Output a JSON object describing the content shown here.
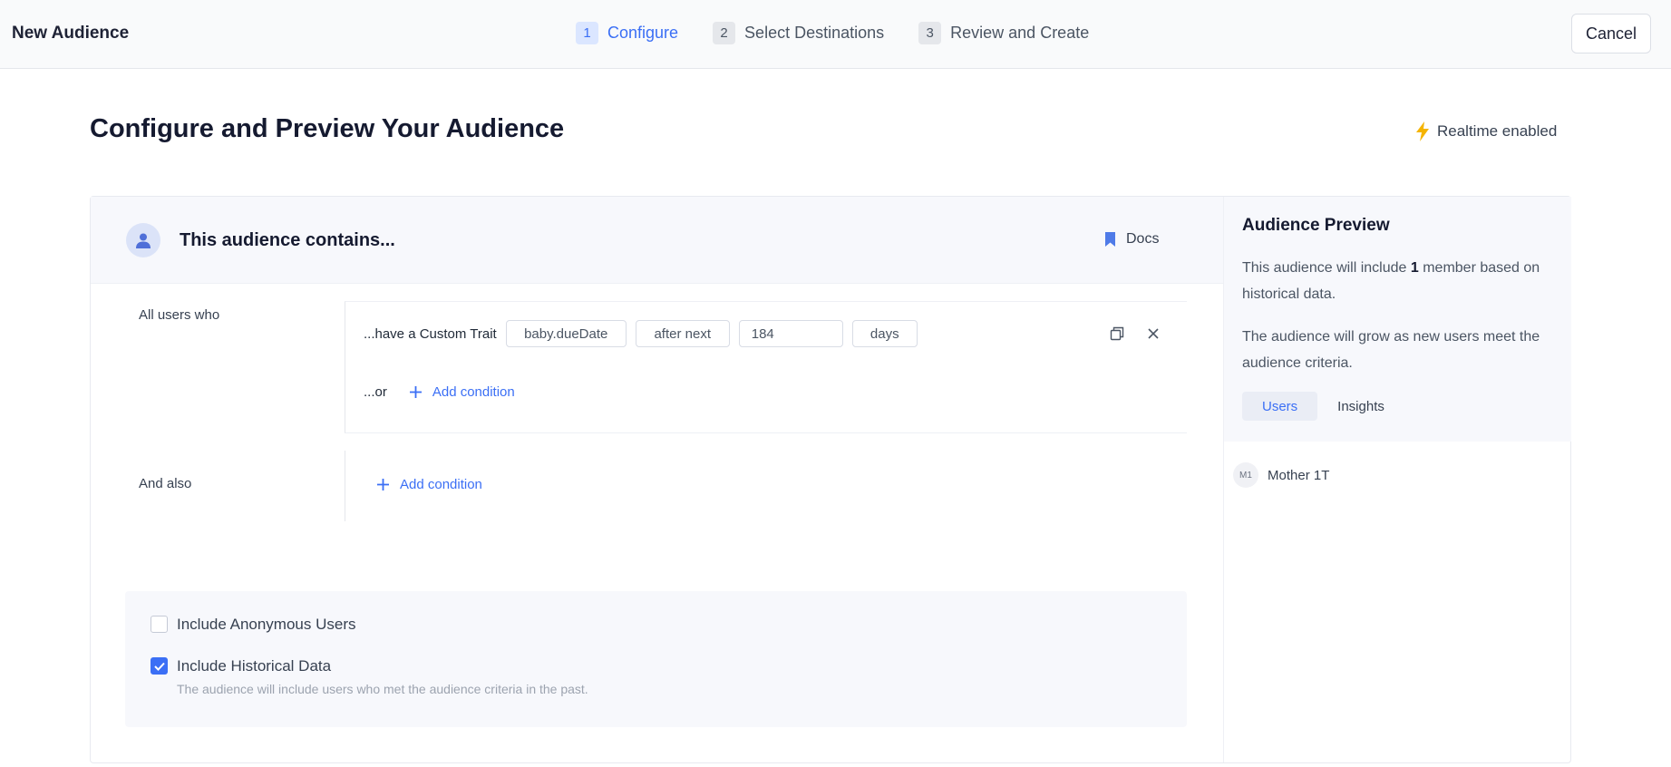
{
  "topbar": {
    "title": "New Audience",
    "steps": [
      {
        "num": "1",
        "label": "Configure",
        "active": true
      },
      {
        "num": "2",
        "label": "Select Destinations",
        "active": false
      },
      {
        "num": "3",
        "label": "Review and Create",
        "active": false
      }
    ],
    "cancel_label": "Cancel"
  },
  "page": {
    "title": "Configure and Preview Your Audience",
    "realtime_label": "Realtime enabled",
    "realtime_icon": "lightning-icon",
    "accent_color": "#3b6ff5",
    "realtime_color": "#f5b400"
  },
  "builder": {
    "header_title": "This audience contains...",
    "docs_label": "Docs",
    "all_users_label": "All users who",
    "condition": {
      "prefix": "...have a Custom Trait",
      "trait": "baby.dueDate",
      "operator": "after next",
      "value": "184",
      "unit": "days"
    },
    "or_label": "...or",
    "add_condition_label": "Add condition",
    "and_also_label": "And also",
    "add_condition_label_2": "Add condition"
  },
  "options": {
    "anonymous_label": "Include Anonymous Users",
    "anonymous_checked": false,
    "historical_label": "Include Historical Data",
    "historical_checked": true,
    "historical_help": "The audience will include users who met the audience criteria in the past."
  },
  "preview": {
    "title": "Audience Preview",
    "text1_before": "This audience will include ",
    "member_count": "1",
    "text1_after": " member based on historical data.",
    "text2": "The audience will grow as new users meet the audience criteria.",
    "tabs": [
      "Users",
      "Insights"
    ],
    "members": [
      {
        "initials": "M1",
        "name": "Mother 1T"
      }
    ]
  }
}
